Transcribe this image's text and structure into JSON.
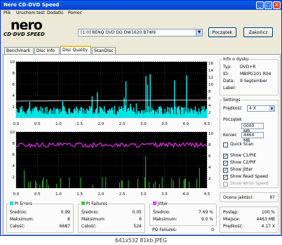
{
  "window": {
    "title": "Nero CD-DVD Speed",
    "min": "_",
    "max": "□",
    "close": "×"
  },
  "menu": [
    "Plik",
    "Uruchom test",
    "Dodatki",
    "Pomoc"
  ],
  "logo": {
    "line1": "nero",
    "line2": "CD·DVD SPEED"
  },
  "drive": {
    "selected": "[1:0]  BENQ DVD DD DW1620 B7W9"
  },
  "buttons": {
    "start": "Początek",
    "end": "Zakończ"
  },
  "tabs": [
    "Benchmark",
    "Disc Info",
    "Disc Quality",
    "ScanDisc"
  ],
  "active_tab": "Disc Quality",
  "disc_info": {
    "title": "Info o dysku",
    "rows": [
      {
        "label": "Typ:",
        "value": "DVD+R"
      },
      {
        "label": "ID:",
        "value": "MBIPG101 R04"
      },
      {
        "label": "Data:",
        "value": "9 September"
      },
      {
        "label": "Label:",
        "value": ""
      }
    ]
  },
  "settings": {
    "title": "Settings",
    "speed_label": "Prędkość",
    "speed_value": "4 X",
    "start_label": "Początek",
    "start_value": "0000 MB",
    "end_label": "Koniec",
    "end_value": "4464 MB",
    "quick_scan": "Quick Scan",
    "checks": [
      {
        "label": "Show C1/PIE",
        "checked": true
      },
      {
        "label": "Show C2/PIF",
        "checked": true
      },
      {
        "label": "Show Jitter",
        "checked": true
      },
      {
        "label": "Show Read Speed",
        "checked": true
      },
      {
        "label": "Show Write Speed",
        "checked": false
      }
    ]
  },
  "quality": {
    "label": "Ocena jakości:",
    "value": "97"
  },
  "progress": {
    "rows": [
      {
        "label": "Postęp:",
        "value": "100 %"
      },
      {
        "label": "Miejsce:",
        "value": "4463 MB"
      },
      {
        "label": "Prędkość:",
        "value": "4.17 X"
      }
    ]
  },
  "stats": {
    "pie": {
      "title": "PI Errors",
      "color": "#00e5e5",
      "rows": [
        {
          "label": "Średnio:",
          "value": "0.99"
        },
        {
          "label": "Maksimum:",
          "value": "8"
        },
        {
          "label": "Całość:",
          "value": "6687"
        }
      ]
    },
    "pif": {
      "title": "PI Failures",
      "color": "#33cc33",
      "rows": [
        {
          "label": "Średnio:",
          "value": "0.05"
        },
        {
          "label": "Maksimum:",
          "value": "6"
        },
        {
          "label": "Całość:",
          "value": "524"
        }
      ]
    },
    "jitter": {
      "title": "Jitter",
      "color": "#ff33ff",
      "rows": [
        {
          "label": "Średnio:",
          "value": "7.69 %"
        },
        {
          "label": "Maksimum:",
          "value": "9.0 %"
        }
      ]
    },
    "po_failures": {
      "label": "PO Failures:",
      "value": "0"
    }
  },
  "chart_data": [
    {
      "type": "bar",
      "name": "PI Errors",
      "x_ticks": [
        "0.0",
        "0.5",
        "1.0",
        "1.5",
        "2.0",
        "2.5",
        "3.0",
        "3.5",
        "4.0",
        "4.5"
      ],
      "y_left_ticks": [
        "10",
        "8",
        "6",
        "4",
        "2"
      ],
      "y_right_ticks": [
        "16",
        "14",
        "12",
        "10",
        "8",
        "6",
        "4",
        "2"
      ],
      "xlim": [
        0,
        4.5
      ],
      "ylim": [
        0,
        10
      ],
      "pie_max": 8,
      "series": [
        {
          "name": "PI Errors",
          "color": "#00e5e5"
        },
        {
          "name": "Read Speed",
          "color": "#ffffff"
        }
      ]
    },
    {
      "type": "bar",
      "name": "PI Failures / Jitter",
      "x_ticks": [
        "0.0",
        "0.5",
        "1.0",
        "1.5",
        "2.0",
        "2.5",
        "3.0",
        "3.5",
        "4.0",
        "4.5"
      ],
      "y_left_ticks": [
        "10",
        "8",
        "6",
        "4",
        "2"
      ],
      "y_right_ticks": [
        "10",
        "8",
        "6",
        "4",
        "2"
      ],
      "xlim": [
        0,
        4.5
      ],
      "ylim": [
        0,
        10
      ],
      "pif_max": 6,
      "jitter_avg": 7.69,
      "series": [
        {
          "name": "PI Failures",
          "color": "#33cc33"
        },
        {
          "name": "Jitter",
          "color": "#ff33ff"
        }
      ]
    }
  ],
  "jpeg_caption": "641x532 81kb JPEG"
}
